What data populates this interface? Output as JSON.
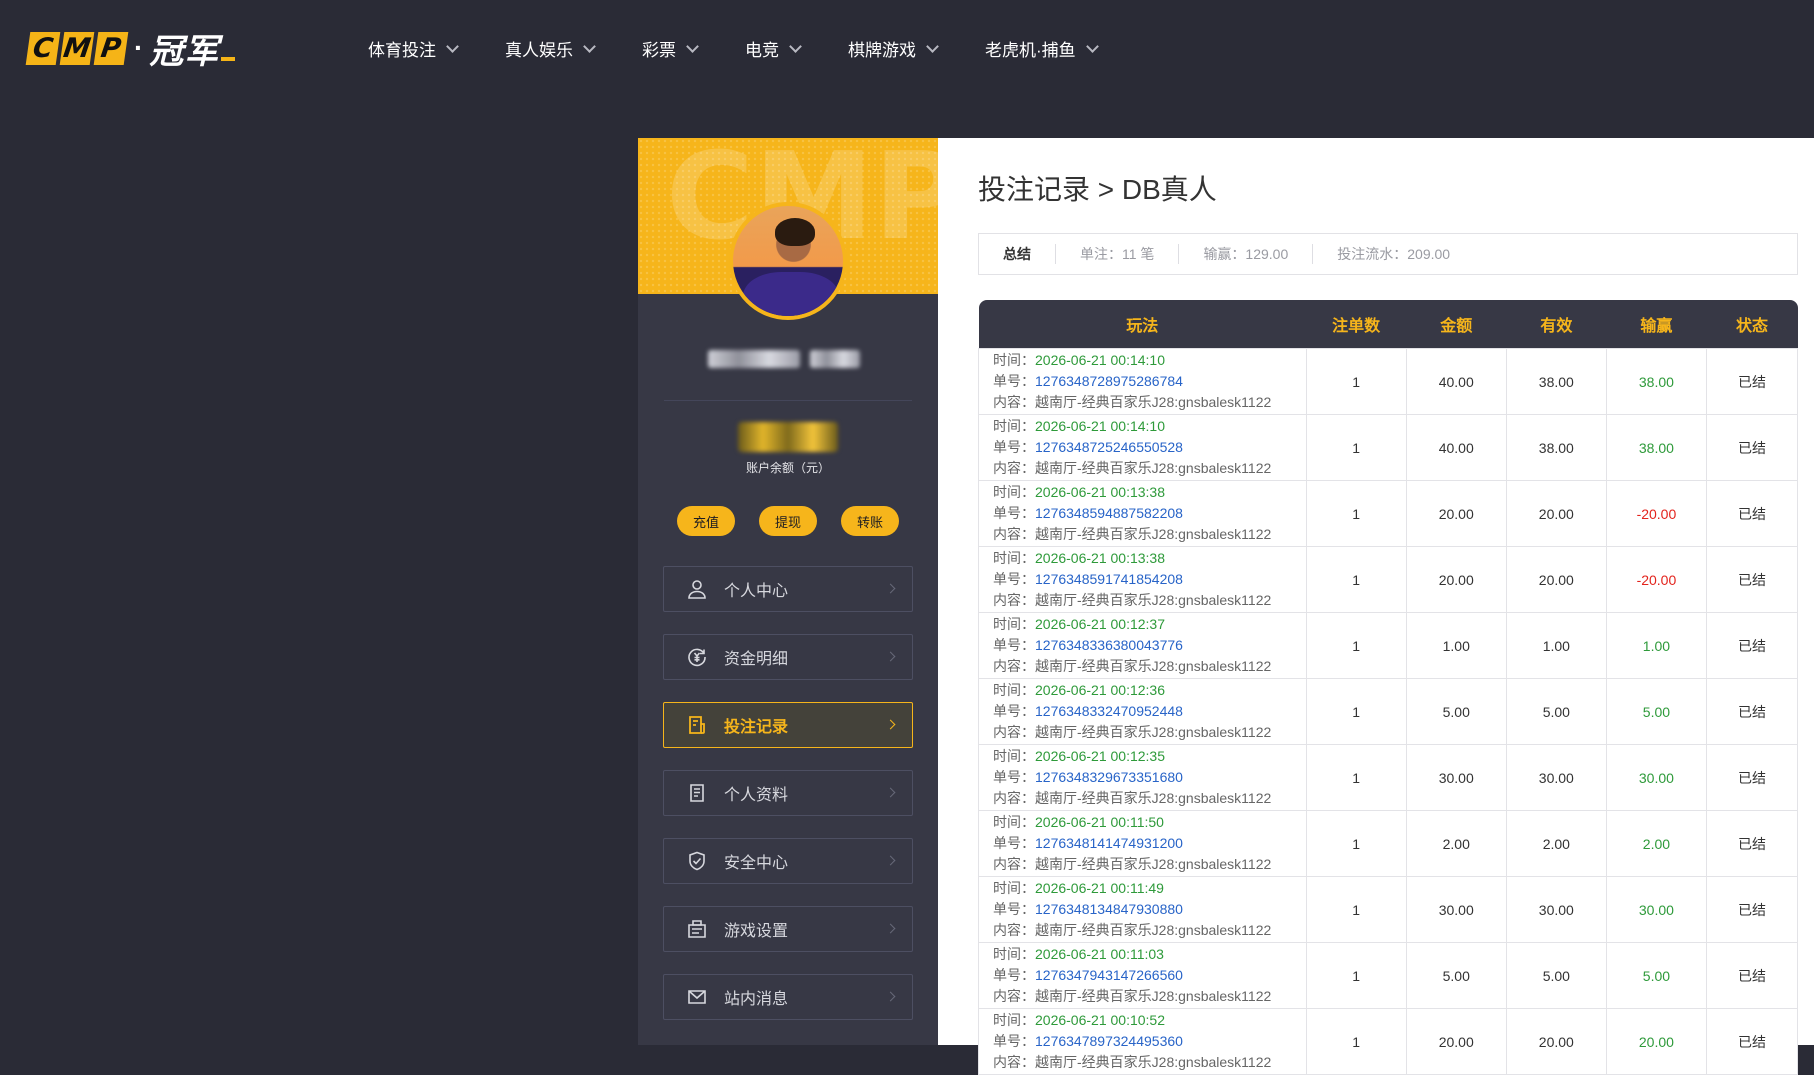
{
  "brand": {
    "letters": [
      "C",
      "M",
      "P"
    ],
    "dot": "·",
    "cn": "冠军"
  },
  "nav": [
    {
      "label": "体育投注"
    },
    {
      "label": "真人娱乐"
    },
    {
      "label": "彩票"
    },
    {
      "label": "电竞"
    },
    {
      "label": "棋牌游戏"
    },
    {
      "label": "老虎机·捕鱼"
    }
  ],
  "sidebar": {
    "watermark": "CMP",
    "balance_label": "账户余额（元）",
    "fund_buttons": [
      "充值",
      "提现",
      "转账"
    ],
    "menu": [
      {
        "label": "个人中心",
        "icon": "user-icon"
      },
      {
        "label": "资金明细",
        "icon": "yuan-cycle-icon"
      },
      {
        "label": "投注记录",
        "icon": "bet-record-icon",
        "active": true
      },
      {
        "label": "个人资料",
        "icon": "profile-doc-icon"
      },
      {
        "label": "安全中心",
        "icon": "shield-check-icon"
      },
      {
        "label": "游戏设置",
        "icon": "game-settings-icon"
      },
      {
        "label": "站内消息",
        "icon": "mail-icon"
      }
    ]
  },
  "main": {
    "breadcrumb": "投注记录 > DB真人",
    "summary": {
      "title": "总结",
      "bets": "单注：11 笔",
      "winloss": "输赢：129.00",
      "turnover": "投注流水：209.00"
    },
    "table": {
      "headers": [
        "玩法",
        "注单数",
        "金额",
        "有效",
        "输赢",
        "状态"
      ],
      "labels": {
        "time": "时间：",
        "no": "单号：",
        "content": "内容："
      },
      "rows": [
        {
          "time": "2026-06-21 00:14:10",
          "no": "1276348728975286784",
          "content": "越南厅-经典百家乐J28:gnsbalesk1122",
          "count": "1",
          "amount": "40.00",
          "valid": "38.00",
          "winloss": "38.00",
          "status": "已结"
        },
        {
          "time": "2026-06-21 00:14:10",
          "no": "1276348725246550528",
          "content": "越南厅-经典百家乐J28:gnsbalesk1122",
          "count": "1",
          "amount": "40.00",
          "valid": "38.00",
          "winloss": "38.00",
          "status": "已结"
        },
        {
          "time": "2026-06-21 00:13:38",
          "no": "1276348594887582208",
          "content": "越南厅-经典百家乐J28:gnsbalesk1122",
          "count": "1",
          "amount": "20.00",
          "valid": "20.00",
          "winloss": "-20.00",
          "status": "已结"
        },
        {
          "time": "2026-06-21 00:13:38",
          "no": "1276348591741854208",
          "content": "越南厅-经典百家乐J28:gnsbalesk1122",
          "count": "1",
          "amount": "20.00",
          "valid": "20.00",
          "winloss": "-20.00",
          "status": "已结"
        },
        {
          "time": "2026-06-21 00:12:37",
          "no": "1276348336380043776",
          "content": "越南厅-经典百家乐J28:gnsbalesk1122",
          "count": "1",
          "amount": "1.00",
          "valid": "1.00",
          "winloss": "1.00",
          "status": "已结"
        },
        {
          "time": "2026-06-21 00:12:36",
          "no": "1276348332470952448",
          "content": "越南厅-经典百家乐J28:gnsbalesk1122",
          "count": "1",
          "amount": "5.00",
          "valid": "5.00",
          "winloss": "5.00",
          "status": "已结"
        },
        {
          "time": "2026-06-21 00:12:35",
          "no": "1276348329673351680",
          "content": "越南厅-经典百家乐J28:gnsbalesk1122",
          "count": "1",
          "amount": "30.00",
          "valid": "30.00",
          "winloss": "30.00",
          "status": "已结"
        },
        {
          "time": "2026-06-21 00:11:50",
          "no": "1276348141474931200",
          "content": "越南厅-经典百家乐J28:gnsbalesk1122",
          "count": "1",
          "amount": "2.00",
          "valid": "2.00",
          "winloss": "2.00",
          "status": "已结"
        },
        {
          "time": "2026-06-21 00:11:49",
          "no": "1276348134847930880",
          "content": "越南厅-经典百家乐J28:gnsbalesk1122",
          "count": "1",
          "amount": "30.00",
          "valid": "30.00",
          "winloss": "30.00",
          "status": "已结"
        },
        {
          "time": "2026-06-21 00:11:03",
          "no": "1276347943147266560",
          "content": "越南厅-经典百家乐J28:gnsbalesk1122",
          "count": "1",
          "amount": "5.00",
          "valid": "5.00",
          "winloss": "5.00",
          "status": "已结"
        },
        {
          "time": "2026-06-21 00:10:52",
          "no": "1276347897324495360",
          "content": "越南厅-经典百家乐J28:gnsbalesk1122",
          "count": "1",
          "amount": "20.00",
          "valid": "20.00",
          "winloss": "20.00",
          "status": "已结"
        }
      ]
    }
  },
  "colors": {
    "accent": "#f6b51b",
    "bg": "#2a2b36",
    "sidebar": "#373845",
    "win": "#2e9a3a",
    "lose": "#e3231c",
    "link": "#2864c8"
  }
}
